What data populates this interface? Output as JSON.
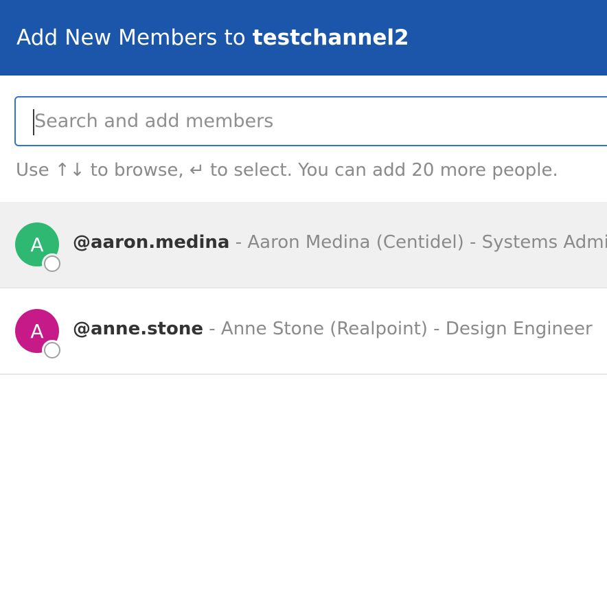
{
  "header": {
    "title_prefix": "Add New Members to",
    "channel_name": "testchannel2",
    "background_color": "#1b56aa"
  },
  "search": {
    "placeholder": "Search and add members",
    "value": "",
    "border_color": "#2d73d8"
  },
  "help_text": "Use ↑↓ to browse, ↵ to select. You can add 20 more people.",
  "users": [
    {
      "initial": "A",
      "username": "@aaron.medina",
      "details": " - Aaron Medina (Centidel) - Systems Administrat",
      "avatar_color": "#2eb872",
      "status": "offline",
      "selected": true
    },
    {
      "initial": "A",
      "username": "@anne.stone",
      "details": " - Anne Stone (Realpoint) - Design Engineer",
      "avatar_color": "#c51a88",
      "status": "offline",
      "selected": false
    }
  ]
}
